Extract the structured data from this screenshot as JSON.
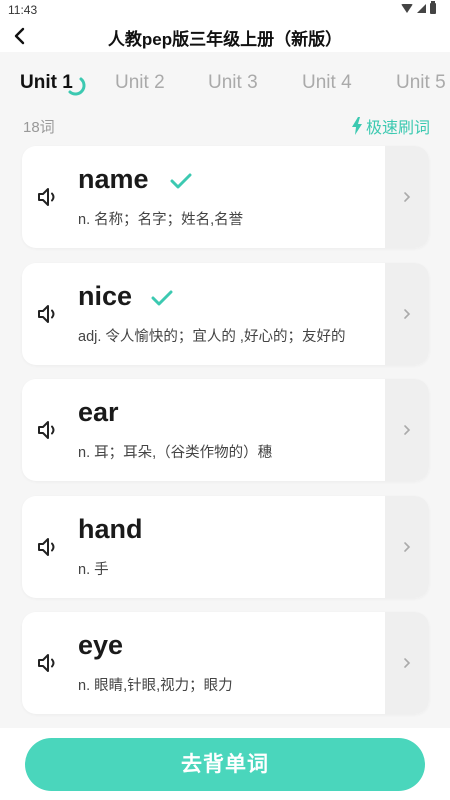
{
  "status_bar": {
    "time": "11:43"
  },
  "app_bar": {
    "title": "人教pep版三年级上册（新版）"
  },
  "tabs": [
    {
      "label": "Unit 1",
      "active": true
    },
    {
      "label": "Unit 2",
      "active": false
    },
    {
      "label": "Unit 3",
      "active": false
    },
    {
      "label": "Unit 4",
      "active": false
    },
    {
      "label": "Unit 5",
      "active": false
    }
  ],
  "meta": {
    "word_count": "18词",
    "quick_label": "极速刷词"
  },
  "words": [
    {
      "word": "name",
      "meaning": "n. 名称；名字；姓名,名誉",
      "learned": true
    },
    {
      "word": "nice",
      "meaning": "adj. 令人愉快的；宜人的 ,好心的；友好的",
      "learned": true
    },
    {
      "word": "ear",
      "meaning": "n. 耳；耳朵,（谷类作物的）穗",
      "learned": false
    },
    {
      "word": "hand",
      "meaning": "n. 手",
      "learned": false
    },
    {
      "word": "eye",
      "meaning": "n. 眼睛,针眼,视力；眼力",
      "learned": false
    }
  ],
  "cta": {
    "label": "去背单词"
  },
  "colors": {
    "accent": "#3cc9b1",
    "cta_bg": "#4ad6bc",
    "background": "#f6f6f6"
  }
}
